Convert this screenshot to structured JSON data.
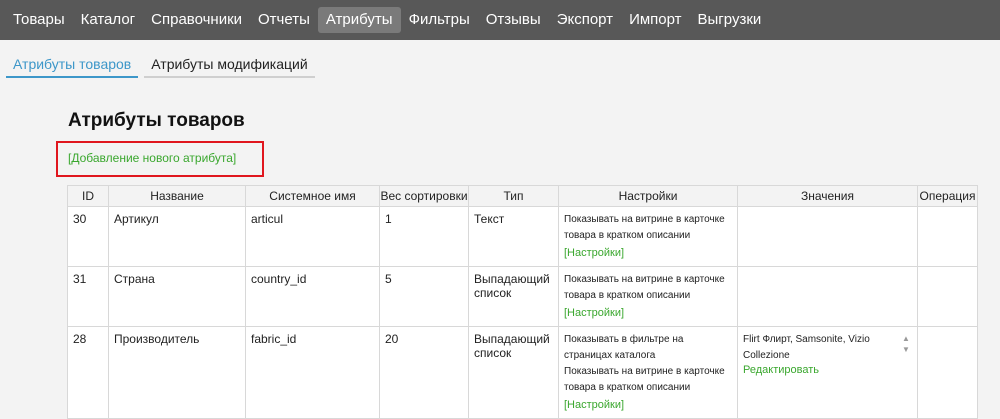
{
  "nav": {
    "items": [
      "Товары",
      "Каталог",
      "Справочники",
      "Отчеты",
      "Атрибуты",
      "Фильтры",
      "Отзывы",
      "Экспорт",
      "Импорт",
      "Выгрузки"
    ],
    "active_index": 4
  },
  "subtabs": [
    "Атрибуты товаров",
    "Атрибуты модификаций"
  ],
  "page": {
    "title": "Атрибуты товаров",
    "add_link": "[Добавление нового атрибута]"
  },
  "table": {
    "headers": [
      "ID",
      "Название",
      "Системное имя",
      "Вес сортировки",
      "Тип",
      "Настройки",
      "Значения",
      "Операция"
    ],
    "rows": [
      {
        "id": "30",
        "name": "Артикул",
        "system_name": "articul",
        "weight": "1",
        "type_line1": "Текст",
        "type_line2": "",
        "setting1": "Показывать на витрине в карточке товара в кратком описании",
        "setting2": "",
        "settings_link": "[Настройки]",
        "values": "",
        "values_link": ""
      },
      {
        "id": "31",
        "name": "Страна",
        "system_name": "country_id",
        "weight": "5",
        "type_line1": "Выпадающий",
        "type_line2": "список",
        "setting1": "Показывать на витрине в карточке товара в кратком описании",
        "setting2": "",
        "settings_link": "[Настройки]",
        "values": "",
        "values_link": ""
      },
      {
        "id": "28",
        "name": "Производитель",
        "system_name": "fabric_id",
        "weight": "20",
        "type_line1": "Выпадающий",
        "type_line2": "список",
        "setting1": "Показывать в фильтре на страницах каталога",
        "setting2": "Показывать на витрине в карточке товара в кратком описании",
        "settings_link": "[Настройки]",
        "values": "Flirt Флирт, Samsonite, Vizio Collezione",
        "values_link": "Редактировать"
      }
    ]
  },
  "colors": {
    "nav_bg": "#585858",
    "accent_link": "#3aa72e",
    "active_tab": "#3d97c9",
    "highlight": "#e0161e"
  }
}
